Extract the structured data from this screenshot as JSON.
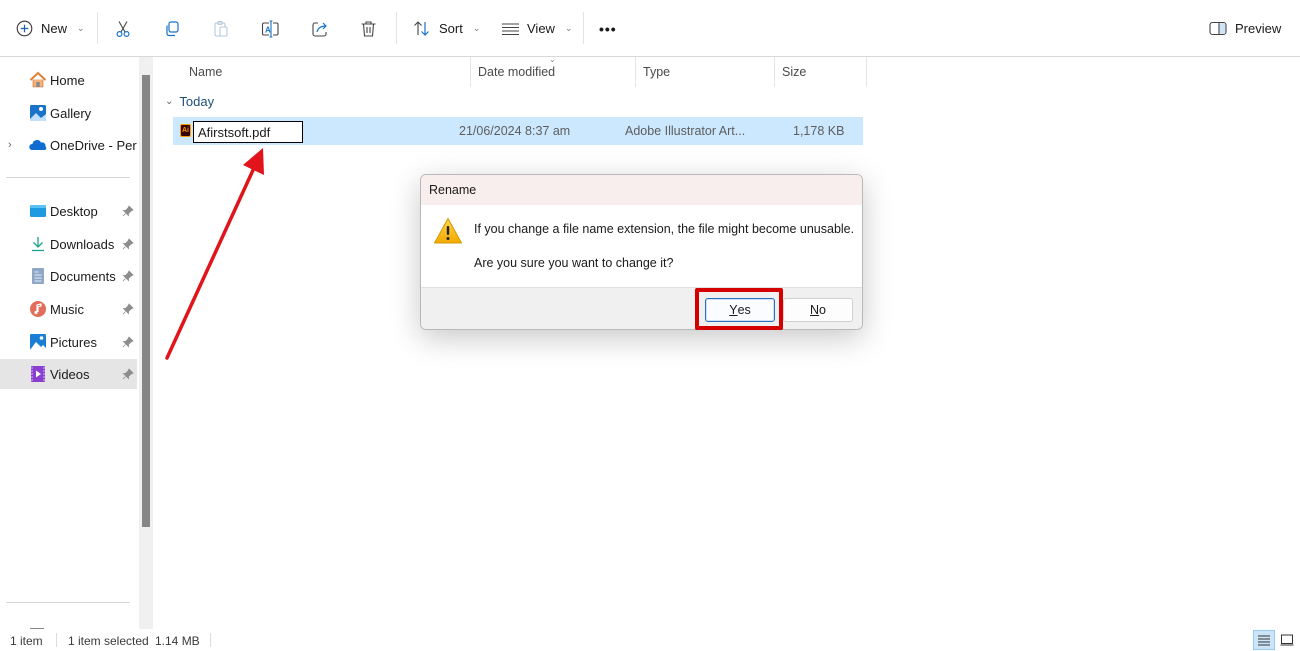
{
  "toolbar": {
    "new_label": "New",
    "sort_label": "Sort",
    "view_label": "View",
    "more_label": "•••",
    "preview_label": "Preview",
    "icons": [
      "plus-circle-icon",
      "cut-icon",
      "copy-icon",
      "paste-icon",
      "rename-icon",
      "share-icon",
      "delete-icon",
      "sort-icon",
      "view-icon",
      "more-icon",
      "preview-pane-icon"
    ]
  },
  "sidebar": {
    "items": [
      {
        "label": "Home",
        "icon": "home-icon"
      },
      {
        "label": "Gallery",
        "icon": "gallery-icon"
      },
      {
        "label": "OneDrive - Personal",
        "icon": "onedrive-icon",
        "expandable": true
      },
      {
        "label": "Desktop",
        "icon": "desktop-icon",
        "pinned": true
      },
      {
        "label": "Downloads",
        "icon": "downloads-icon",
        "pinned": true
      },
      {
        "label": "Documents",
        "icon": "documents-icon",
        "pinned": true
      },
      {
        "label": "Music",
        "icon": "music-icon",
        "pinned": true
      },
      {
        "label": "Pictures",
        "icon": "pictures-icon",
        "pinned": true
      },
      {
        "label": "Videos",
        "icon": "videos-icon",
        "pinned": true,
        "selected": true
      }
    ]
  },
  "file_list": {
    "columns": [
      "Name",
      "Date modified",
      "Type",
      "Size"
    ],
    "sorted_by": "Date modified",
    "group": "Today",
    "rows": [
      {
        "name": "Afirstsoft.pdf",
        "date_modified": "21/06/2024 8:37 am",
        "type": "Adobe Illustrator Art...",
        "size": "1,178 KB",
        "selected": true,
        "renaming": true,
        "icon": "illustrator-file-icon"
      }
    ]
  },
  "dialog": {
    "title": "Rename",
    "message": "If you change a file name extension, the file might become unusable.",
    "question": "Are you sure you want to change it?",
    "yes_label": "Yes",
    "yes_mnemonic": "Y",
    "yes_rest": "es",
    "no_label": "No",
    "no_mnemonic": "N",
    "no_rest": "o",
    "icon": "warning-icon"
  },
  "statusbar": {
    "item_count": "1 item",
    "selection": "1 item selected",
    "selection_size": "1.14 MB"
  },
  "annotation": {
    "arrow_color": "#e0141a",
    "highlight_color": "#d40000"
  }
}
